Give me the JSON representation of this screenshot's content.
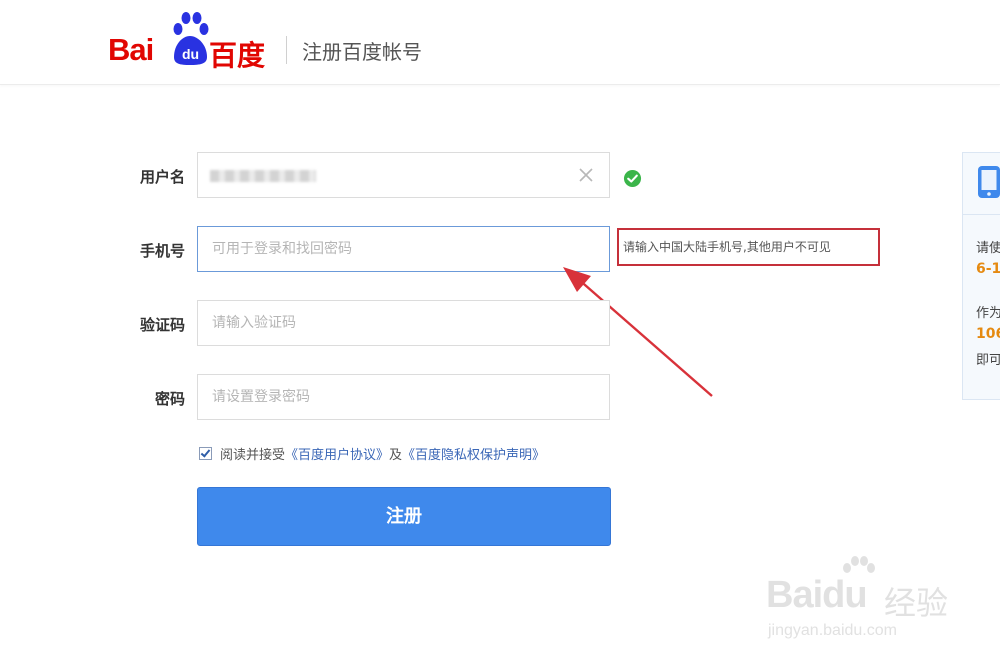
{
  "header": {
    "logo_bai": "Bai",
    "logo_du": "du",
    "logo_cn": "百度",
    "title": "注册百度帐号"
  },
  "form": {
    "username": {
      "label": "用户名",
      "value": "",
      "status": "valid"
    },
    "phone": {
      "label": "手机号",
      "placeholder": "可用于登录和找回密码",
      "hint": "请输入中国大陆手机号,其他用户不可见"
    },
    "code": {
      "label": "验证码",
      "placeholder": "请输入验证码"
    },
    "password": {
      "label": "密码",
      "placeholder": "请设置登录密码"
    },
    "agreement": {
      "prefix": "阅读并接受",
      "link1": "《百度用户协议》",
      "middle": "及",
      "link2": "《百度隐私权保护声明》",
      "checked": true
    },
    "submit_label": "注册"
  },
  "side_panel": {
    "icon": "mobile-phone-icon",
    "line1": "请使",
    "line2": "6-1",
    "line3": "作为",
    "line4": "106",
    "line5": "即可"
  },
  "watermark": {
    "brand": "Baidu",
    "cn": "经验",
    "url": "jingyan.baidu.com"
  },
  "colors": {
    "brand_red": "#e10602",
    "brand_blue": "#2932e1",
    "submit_blue": "#3f89ec",
    "hint_border": "#c5303a",
    "success_green": "#3bb54a",
    "side_orange": "#e58a11"
  }
}
